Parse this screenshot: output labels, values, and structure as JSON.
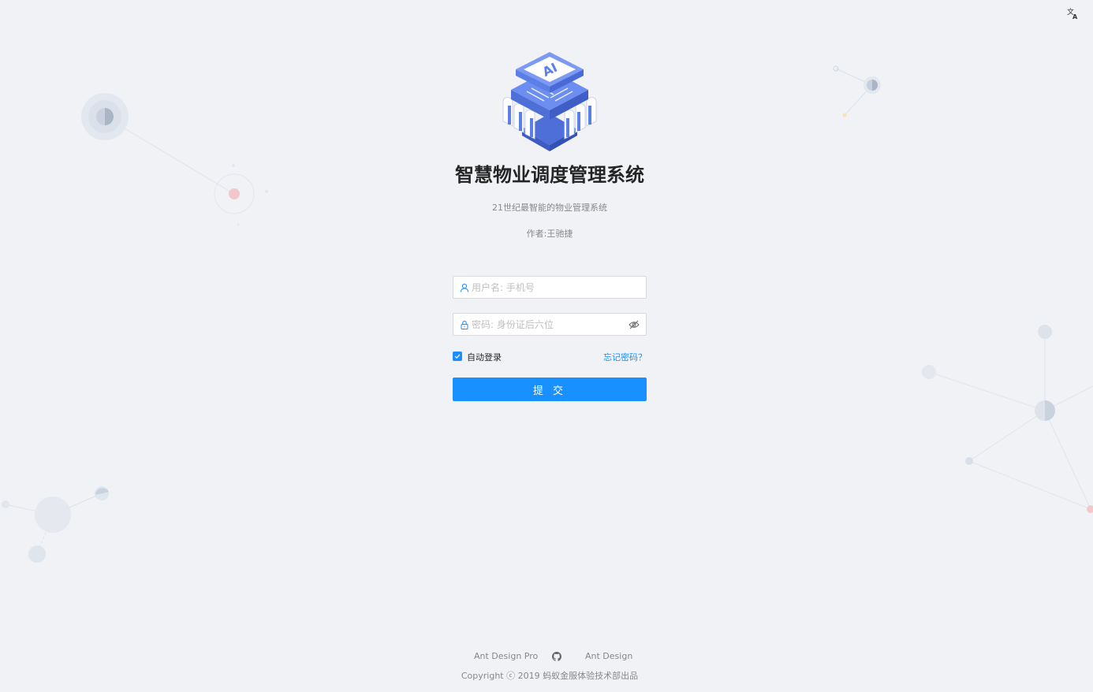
{
  "header": {
    "language_icon": "translate-icon"
  },
  "brand": {
    "logo_icon": "ai-chip-logo",
    "title": "智慧物业调度管理系统",
    "subtitle": "21世纪最智能的物业管理系统",
    "author": "作者:王驰捷"
  },
  "login_form": {
    "username": {
      "icon": "user-icon",
      "placeholder": "用户名: 手机号",
      "value": ""
    },
    "password": {
      "icon": "lock-icon",
      "placeholder": "密码: 身份证后六位",
      "value": "",
      "toggle_icon": "eye-invisible-icon"
    },
    "remember_me": {
      "label": "自动登录",
      "checked": true
    },
    "forgot_password_label": "忘记密码？",
    "submit_label": "提 交"
  },
  "footer": {
    "links": [
      {
        "label": "Ant Design Pro"
      },
      {
        "icon": "github-icon"
      },
      {
        "label": "Ant Design"
      }
    ],
    "copyright": "Copyright ⓒ 2019 蚂蚁金服体验技术部出品"
  },
  "colors": {
    "primary": "#1890ff",
    "background": "#f0f2f5",
    "logo_blue": "#5b7fe6"
  }
}
